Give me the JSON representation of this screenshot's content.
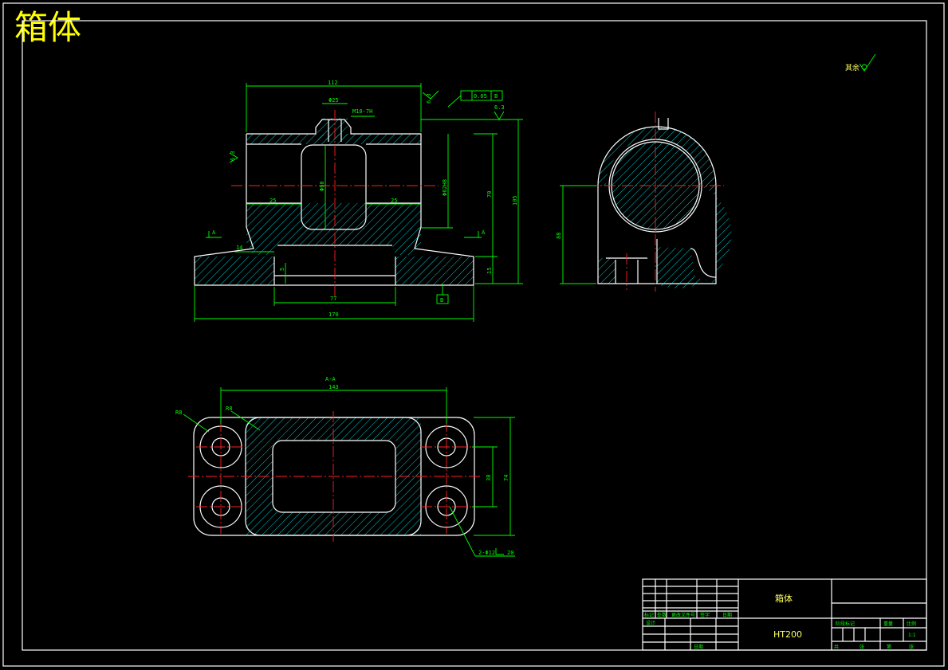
{
  "title": "箱体",
  "roughness_note": "其余",
  "dims": {
    "width_top": "112",
    "bore_small": "Φ25",
    "thread": "M10-7H",
    "gdt_tol": "0.05",
    "gdt_datum": "B",
    "rough_1": "6.3",
    "rough_2": "6.3",
    "rough_3": "6.3",
    "bore_dia": "Φ60",
    "bore_tol": "Φ62H8",
    "d25_left": "25",
    "d25_right": "25",
    "h70": "70",
    "h105": "105",
    "h15": "15",
    "d14": "14",
    "d5": "5",
    "d77": "77",
    "d170": "170",
    "datum": "B",
    "side_h": "88",
    "section": "A-A",
    "d143": "143",
    "r20a": "R8",
    "r20b": "R8",
    "d38": "38",
    "d74": "74",
    "holes": "2-Φ12",
    "hole_depth": "20",
    "sec_a1": "A",
    "sec_a2": "A"
  },
  "title_block": {
    "part_name": "箱体",
    "material": "HT200",
    "scale": "1:1",
    "h_stage": "阶段标记",
    "h_weight": "重量",
    "h_scale": "比例",
    "h_mark": "标记",
    "h_count": "处数",
    "h_doc": "更改文件号",
    "h_sign": "签字",
    "h_date": "日期",
    "h_design": "设计",
    "h_review": "审核",
    "h_approve": "批准",
    "h_total": "共",
    "h_sheet": "张",
    "h_no": "第",
    "h_craft": "工艺",
    "h_day": "日期"
  }
}
